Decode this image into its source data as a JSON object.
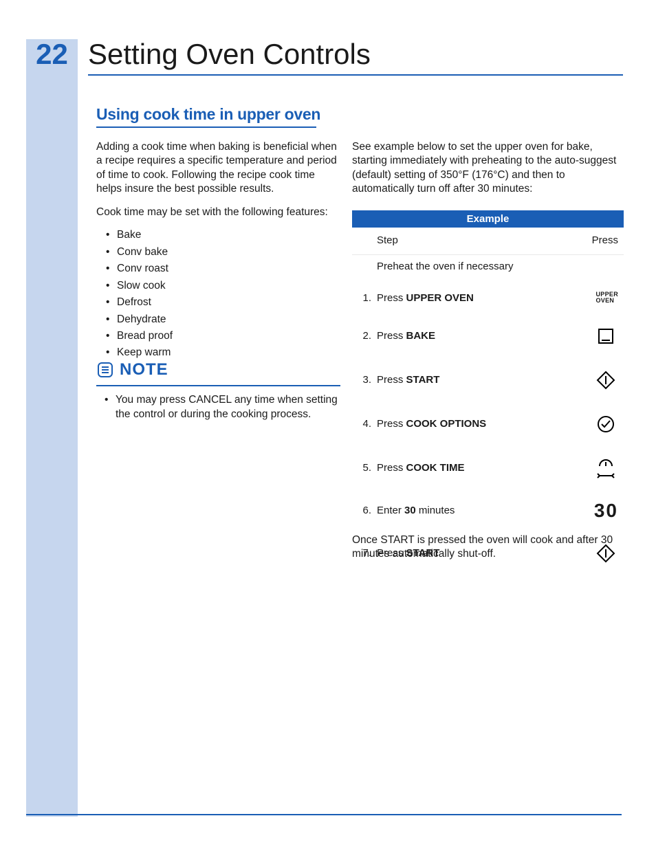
{
  "page_number": "22",
  "title": "Setting Oven Controls",
  "section_heading": "Using cook time in upper oven",
  "left": {
    "p1": "Adding a cook time when baking is beneficial when a recipe requires a specific temperature and period of time to cook. Following the recipe cook time helps insure the best possible results.",
    "p2": "Cook time may be set with the following features:",
    "features": [
      "Bake",
      "Conv bake",
      "Conv roast",
      "Slow cook",
      "Defrost",
      "Dehydrate",
      "Bread proof",
      "Keep warm"
    ]
  },
  "note": {
    "title": "NOTE",
    "items": [
      "You may press CANCEL any time when setting the control or during the cooking process."
    ]
  },
  "right": {
    "intro": "See example below to set the upper oven for bake, starting immediately with preheating to the auto-suggest (default) setting of 350°F (176°C) and then to automatically turn off after 30 minutes:"
  },
  "table": {
    "header": "Example",
    "col_step": "Step",
    "col_press": "Press",
    "preheat": "Preheat the oven if necessary",
    "rows": [
      {
        "n": "1.",
        "pre": "Press ",
        "bold": "UPPER OVEN",
        "post": "",
        "icon": "upper"
      },
      {
        "n": "2.",
        "pre": "Press ",
        "bold": "BAKE",
        "post": "",
        "icon": "bake"
      },
      {
        "n": "3.",
        "pre": "Press ",
        "bold": "START",
        "post": "",
        "icon": "start"
      },
      {
        "n": "4.",
        "pre": "Press ",
        "bold": "COOK OPTIONS",
        "post": "",
        "icon": "options"
      },
      {
        "n": "5.",
        "pre": "Press ",
        "bold": "COOK TIME",
        "post": "",
        "icon": "time"
      },
      {
        "n": "6.",
        "pre": "Enter ",
        "bold": "30",
        "post": " minutes",
        "icon": "num30"
      },
      {
        "n": "7.",
        "pre": "Press ",
        "bold": "START",
        "post": "",
        "icon": "start"
      }
    ],
    "upper_oven_label_l1": "UPPER",
    "upper_oven_label_l2": "OVEN",
    "num30": "30"
  },
  "closing": "Once START is pressed the oven will cook and after 30 minutes automatically shut-off."
}
